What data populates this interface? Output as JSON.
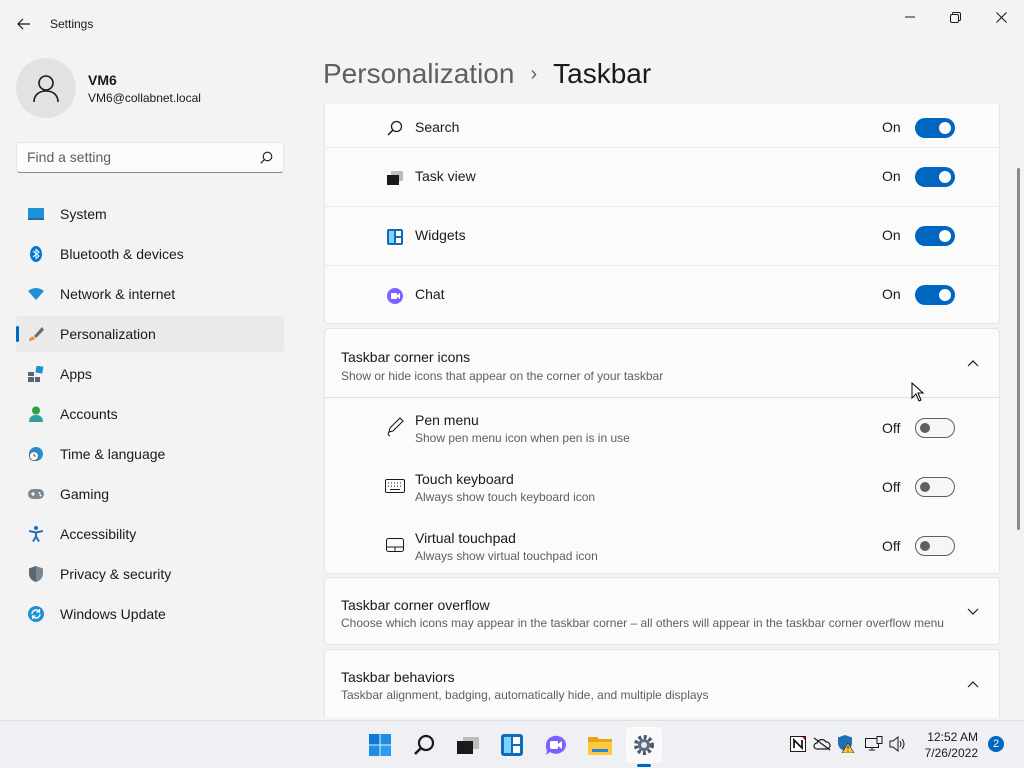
{
  "window": {
    "title": "Settings",
    "icons": {
      "back": "back-arrow-icon",
      "minimize": "minimize-icon",
      "maximize": "restore-icon",
      "close": "close-icon"
    }
  },
  "profile": {
    "name": "VM6",
    "email": "VM6@collabnet.local",
    "avatar_icon": "person-icon"
  },
  "search": {
    "placeholder": "Find a setting",
    "value": ""
  },
  "nav": [
    {
      "label": "System",
      "icon": "system-icon"
    },
    {
      "label": "Bluetooth & devices",
      "icon": "bluetooth-icon"
    },
    {
      "label": "Network & internet",
      "icon": "wifi-icon"
    },
    {
      "label": "Personalization",
      "icon": "brush-icon",
      "active": true
    },
    {
      "label": "Apps",
      "icon": "apps-icon"
    },
    {
      "label": "Accounts",
      "icon": "accounts-icon"
    },
    {
      "label": "Time & language",
      "icon": "globe-clock-icon"
    },
    {
      "label": "Gaming",
      "icon": "gamepad-icon"
    },
    {
      "label": "Accessibility",
      "icon": "accessibility-icon"
    },
    {
      "label": "Privacy & security",
      "icon": "shield-icon"
    },
    {
      "label": "Windows Update",
      "icon": "update-icon"
    }
  ],
  "header": {
    "parent": "Personalization",
    "separator": "›",
    "current": "Taskbar"
  },
  "taskbar_items": [
    {
      "label": "Search",
      "state": "On",
      "on": true,
      "icon": "search-icon"
    },
    {
      "label": "Task view",
      "state": "On",
      "on": true,
      "icon": "task-view-icon"
    },
    {
      "label": "Widgets",
      "state": "On",
      "on": true,
      "icon": "widgets-icon"
    },
    {
      "label": "Chat",
      "state": "On",
      "on": true,
      "icon": "chat-icon"
    }
  ],
  "corner_icons": {
    "title": "Taskbar corner icons",
    "subtitle": "Show or hide icons that appear on the corner of your taskbar",
    "expanded": true,
    "items": [
      {
        "label": "Pen menu",
        "desc": "Show pen menu icon when pen is in use",
        "state": "Off",
        "on": false,
        "icon": "pen-icon"
      },
      {
        "label": "Touch keyboard",
        "desc": "Always show touch keyboard icon",
        "state": "Off",
        "on": false,
        "icon": "keyboard-icon"
      },
      {
        "label": "Virtual touchpad",
        "desc": "Always show virtual touchpad icon",
        "state": "Off",
        "on": false,
        "icon": "touchpad-icon"
      }
    ]
  },
  "corner_overflow": {
    "title": "Taskbar corner overflow",
    "subtitle": "Choose which icons may appear in the taskbar corner – all others will appear in the taskbar corner overflow menu",
    "expanded": false
  },
  "behaviors": {
    "title": "Taskbar behaviors",
    "subtitle": "Taskbar alignment, badging, automatically hide, and multiple displays",
    "expanded": true
  },
  "os_taskbar": {
    "apps": [
      "start-icon",
      "search-icon",
      "task-view-icon",
      "widgets-icon",
      "chat-icon",
      "file-explorer-icon",
      "settings-icon"
    ],
    "tray": [
      "notion-icon",
      "onedrive-icon",
      "defender-warning-icon",
      "network-icon",
      "volume-icon"
    ],
    "time": "12:52 AM",
    "date": "7/26/2022",
    "notifications": "2"
  },
  "colors": {
    "accent": "#0067c0",
    "background": "#f3f3f3",
    "card": "#fbfbfb"
  }
}
